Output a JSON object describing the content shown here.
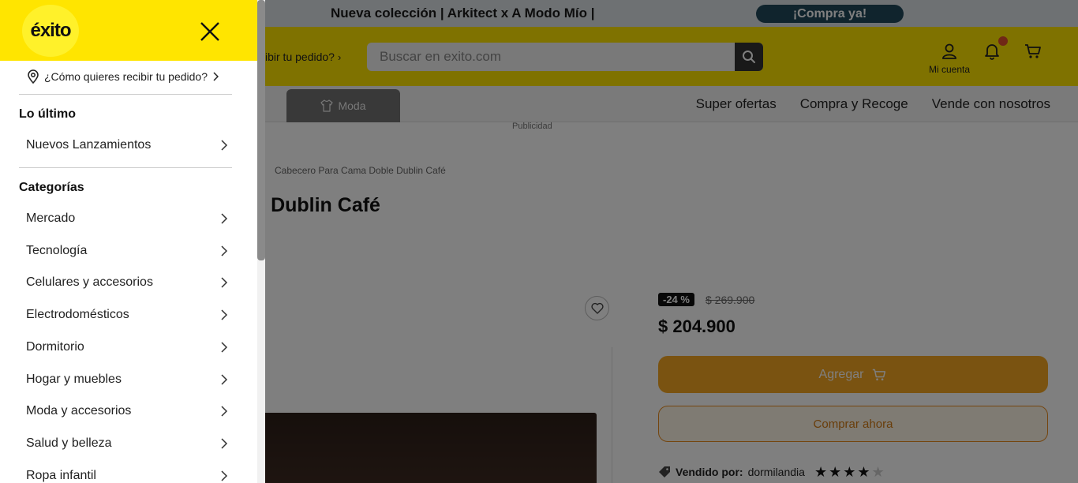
{
  "promo": {
    "text": "Nueva colección | Arkitect x A Modo Mío |",
    "cta": "¡Compra ya!"
  },
  "header": {
    "delivery_partial": "ibir tu pedido?",
    "search_placeholder": "Buscar en exito.com",
    "account_label": "Mi cuenta"
  },
  "nav": {
    "active_tab": "Moda",
    "links": [
      "Super ofertas",
      "Compra y Recoge",
      "Vende con nosotros"
    ]
  },
  "ad_label": "Publicidad",
  "product": {
    "breadcrumb": "Cabecero Para Cama Doble Dublin Café",
    "title_visible": "ble Dublin Café",
    "discount": "-24 %",
    "old_price": "$ 269.900",
    "price": "$ 204.900",
    "add_label": "Agregar",
    "buy_label": "Comprar ahora",
    "seller_prefix": "Vendido por:",
    "seller_name": "dormilandia",
    "rating": 4,
    "rating_max": 5
  },
  "drawer": {
    "logo_text": "éxito",
    "delivery_question": "¿Cómo quieres recibir tu pedido?",
    "latest_title": "Lo último",
    "latest_items": [
      {
        "label": "Nuevos Lanzamientos"
      }
    ],
    "categories_title": "Categorías",
    "categories": [
      {
        "label": "Mercado"
      },
      {
        "label": "Tecnología"
      },
      {
        "label": "Celulares y accesorios"
      },
      {
        "label": "Electrodomésticos"
      },
      {
        "label": "Dormitorio"
      },
      {
        "label": "Hogar y muebles"
      },
      {
        "label": "Moda y accesorios"
      },
      {
        "label": "Salud y belleza"
      },
      {
        "label": "Ropa infantil"
      }
    ]
  },
  "colors": {
    "brand_yellow": "#ffe500",
    "promo_button": "#21485a",
    "cta_orange": "#f5a623"
  }
}
